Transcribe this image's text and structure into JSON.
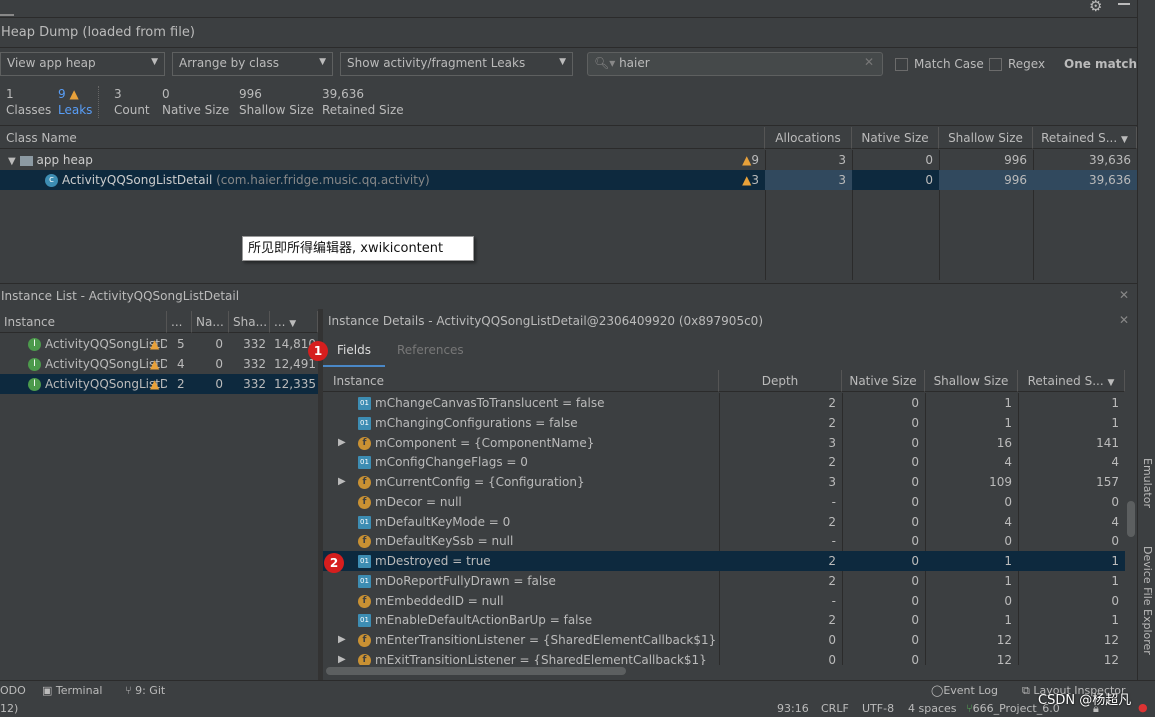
{
  "header": {
    "title": "Heap Dump (loaded from file)"
  },
  "toolbar": {
    "heap": "View app heap",
    "arrange": "Arrange by class",
    "filter": "Show activity/fragment Leaks",
    "search_value": "haier",
    "match_case": "Match Case",
    "regex": "Regex",
    "match_status": "One match"
  },
  "stats": [
    {
      "value": "1",
      "label": "Classes"
    },
    {
      "value": "9",
      "label": "Leaks"
    },
    {
      "value": "3",
      "label": "Count"
    },
    {
      "value": "0",
      "label": "Native Size"
    },
    {
      "value": "996",
      "label": "Shallow Size"
    },
    {
      "value": "39,636",
      "label": "Retained Size"
    }
  ],
  "class_table": {
    "headers": [
      "Class Name",
      "Allocations",
      "Native Size",
      "Shallow Size",
      "Retained S..."
    ],
    "rows": [
      {
        "name": "app heap",
        "pkg": "",
        "leaks": "9",
        "alloc": "3",
        "native": "0",
        "shallow": "996",
        "retained": "39,636"
      },
      {
        "name": "ActivityQQSongListDetail",
        "pkg": "(com.haier.fridge.music.qq.activity)",
        "leaks": "3",
        "alloc": "3",
        "native": "0",
        "shallow": "996",
        "retained": "39,636"
      }
    ]
  },
  "tooltip": "所见即所得编辑器, xwikicontent",
  "instance_list": {
    "title": "Instance List - ActivityQQSongListDetail",
    "headers": [
      "Instance",
      "...",
      "Na...",
      "Sha...",
      "..."
    ],
    "rows": [
      {
        "name": "ActivityQQSongListD",
        "depth": "5",
        "native": "0",
        "shallow": "332",
        "retained": "14,810"
      },
      {
        "name": "ActivityQQSongListD",
        "depth": "4",
        "native": "0",
        "shallow": "332",
        "retained": "12,491"
      },
      {
        "name": "ActivityQQSongListD",
        "depth": "2",
        "native": "0",
        "shallow": "332",
        "retained": "12,335"
      }
    ]
  },
  "instance_details": {
    "title": "Instance Details - ActivityQQSongListDetail@2306409920 (0x897905c0)",
    "tabs": [
      "Fields",
      "References"
    ],
    "headers": [
      "Instance",
      "Depth",
      "Native Size",
      "Shallow Size",
      "Retained S..."
    ],
    "rows": [
      {
        "type": "o1",
        "exp": false,
        "name": "mChangeCanvasToTranslucent = false",
        "depth": "2",
        "native": "0",
        "shallow": "1",
        "retained": "1"
      },
      {
        "type": "o1",
        "exp": false,
        "name": "mChangingConfigurations = false",
        "depth": "2",
        "native": "0",
        "shallow": "1",
        "retained": "1"
      },
      {
        "type": "f",
        "exp": true,
        "name": "mComponent = {ComponentName}",
        "depth": "3",
        "native": "0",
        "shallow": "16",
        "retained": "141"
      },
      {
        "type": "o1",
        "exp": false,
        "name": "mConfigChangeFlags = 0",
        "depth": "2",
        "native": "0",
        "shallow": "4",
        "retained": "4"
      },
      {
        "type": "f",
        "exp": true,
        "name": "mCurrentConfig = {Configuration}",
        "depth": "3",
        "native": "0",
        "shallow": "109",
        "retained": "157"
      },
      {
        "type": "f",
        "exp": false,
        "name": "mDecor = null",
        "depth": "-",
        "native": "0",
        "shallow": "0",
        "retained": "0"
      },
      {
        "type": "o1",
        "exp": false,
        "name": "mDefaultKeyMode = 0",
        "depth": "2",
        "native": "0",
        "shallow": "4",
        "retained": "4"
      },
      {
        "type": "f",
        "exp": false,
        "name": "mDefaultKeySsb = null",
        "depth": "-",
        "native": "0",
        "shallow": "0",
        "retained": "0"
      },
      {
        "type": "o1",
        "exp": false,
        "name": "mDestroyed = true",
        "depth": "2",
        "native": "0",
        "shallow": "1",
        "retained": "1",
        "selected": true
      },
      {
        "type": "o1",
        "exp": false,
        "name": "mDoReportFullyDrawn = false",
        "depth": "2",
        "native": "0",
        "shallow": "1",
        "retained": "1"
      },
      {
        "type": "f",
        "exp": false,
        "name": "mEmbeddedID = null",
        "depth": "-",
        "native": "0",
        "shallow": "0",
        "retained": "0"
      },
      {
        "type": "o1",
        "exp": false,
        "name": "mEnableDefaultActionBarUp = false",
        "depth": "2",
        "native": "0",
        "shallow": "1",
        "retained": "1"
      },
      {
        "type": "f",
        "exp": true,
        "name": "mEnterTransitionListener = {SharedElementCallback$1}",
        "depth": "0",
        "native": "0",
        "shallow": "12",
        "retained": "12"
      },
      {
        "type": "f",
        "exp": true,
        "name": "mExitTransitionListener = {SharedElementCallback$1}",
        "depth": "0",
        "native": "0",
        "shallow": "12",
        "retained": "12"
      }
    ]
  },
  "badges": [
    "1",
    "2"
  ],
  "side_tools": [
    "Emulator",
    "Device File Explorer"
  ],
  "bottom_tools": {
    "todo": "ODO",
    "terminal": "Terminal",
    "git": "9: Git",
    "event_log": "Event Log",
    "layout_inspector": "Layout Inspector"
  },
  "status": {
    "left": "12)",
    "position": "93:16",
    "line_sep": "CRLF",
    "encoding": "UTF-8",
    "indent": "4 spaces",
    "branch": "666_Project_6.0"
  },
  "watermark": "CSDN @杨超凡",
  "colors": {
    "selection": "#0d293e",
    "leak_warning": "#e8a13a",
    "link": "#589df6",
    "badge": "#d61e1e"
  }
}
